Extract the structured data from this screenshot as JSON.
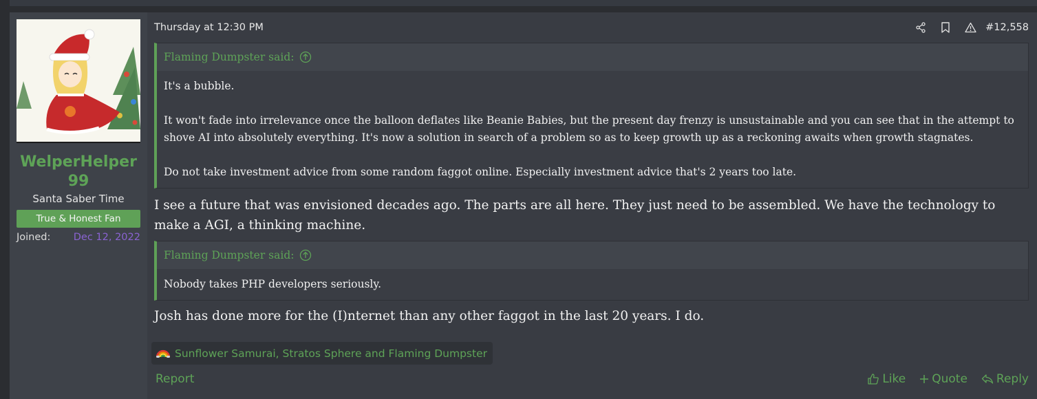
{
  "post": {
    "date": "Thursday at 12:30 PM",
    "number": "#12,558",
    "tool_icons": [
      "share-icon",
      "bookmark-icon",
      "report-warning-icon"
    ]
  },
  "user": {
    "name": "WelperHelper99",
    "title": "Santa Saber Time",
    "banner": "True & Honest Fan",
    "joined_label": "Joined:",
    "joined_date": "Dec 12, 2022",
    "avatar_icon": "santa-saber-avatar"
  },
  "quotes": [
    {
      "author_said": "Flaming Dumpster said:",
      "paragraphs": [
        "It's a bubble.",
        "It won't fade into irrelevance once the balloon deflates like Beanie Babies, but the present day frenzy is unsustainable and you can see that in the attempt to shove AI into absolutely everything. It's now a solution in search of a problem so as to keep growth up as a reckoning awaits when growth stagnates.",
        "Do not take investment advice from some random faggot online. Especially investment advice that's 2 years too late."
      ]
    },
    {
      "author_said": "Flaming Dumpster said:",
      "paragraphs": [
        "Nobody takes PHP developers seriously."
      ]
    }
  ],
  "replies": [
    "I see a future that was envisioned decades ago. The parts are all here. They just need to be assembled. We have the technology to make a AGI, a thinking machine.",
    "Josh has done more for the (I)nternet than any other faggot in the last 20 years. I do."
  ],
  "reactions": {
    "icon": "rainbow-icon",
    "names": "Sunflower Samurai, Stratos Sphere and Flaming Dumpster"
  },
  "footer": {
    "report": "Report",
    "like": "Like",
    "quote": "Quote",
    "reply": "Reply"
  },
  "colors": {
    "accent_green": "#5ea357",
    "joined_date": "#8a63d2",
    "background": "#393c43"
  }
}
